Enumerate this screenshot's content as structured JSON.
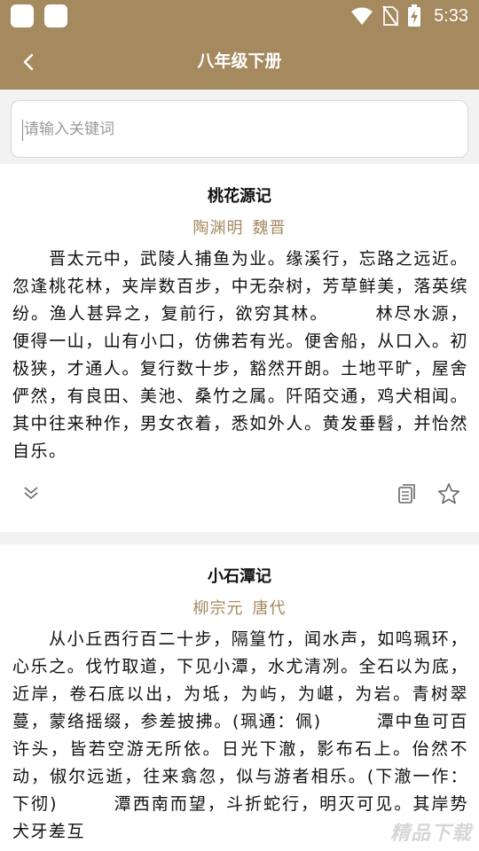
{
  "status_bar": {
    "time": "5:33",
    "icons": [
      "wifi-icon",
      "no-sim-icon",
      "battery-charging-icon"
    ]
  },
  "nav": {
    "title": "八年级下册",
    "back_icon": "chevron-left-icon"
  },
  "search": {
    "placeholder": "请输入关键词",
    "value": ""
  },
  "poems": [
    {
      "title": "桃花源记",
      "author": "陶渊明",
      "dynasty": "魏晋",
      "body": "　　晋太元中，武陵人捕鱼为业。缘溪行，忘路之远近。忽逢桃花林，夹岸数百步，中无杂树，芳草鲜美，落英缤纷。渔人甚异之，复前行，欲穷其林。　　　林尽水源，便得一山，山有小口，仿佛若有光。便舍船，从口入。初极狭，才通人。复行数十步，豁然开朗。土地平旷，屋舍俨然，有良田、美池、桑竹之属。阡陌交通，鸡犬相闻。其中往来种作，男女衣着，悉如外人。黄发垂髫，并怡然自乐。"
    },
    {
      "title": "小石潭记",
      "author": "柳宗元",
      "dynasty": "唐代",
      "body": "　　从小丘西行百二十步，隔篁竹，闻水声，如鸣珮环，心乐之。伐竹取道，下见小潭，水尤清冽。全石以为底，近岸，卷石底以出，为坻，为屿，为嵁，为岩。青树翠蔓，蒙络摇缀，参差披拂。(珮通：佩)　　　潭中鱼可百许头，皆若空游无所依。日光下澈，影布石上。佁然不动，俶尔远逝，往来翕忽，似与游者相乐。(下澈一作：下彻)　　　潭西南而望，斗折蛇行，明灭可见。其岸势犬牙差互"
    }
  ],
  "actions": {
    "expand_icon": "double-chevron-down-icon",
    "copy_icon": "copy-icon",
    "favorite_icon": "star-icon"
  },
  "colors": {
    "accent": "#a5895f",
    "background": "#f2f2f2",
    "card": "#ffffff"
  },
  "watermark": "精品下载"
}
